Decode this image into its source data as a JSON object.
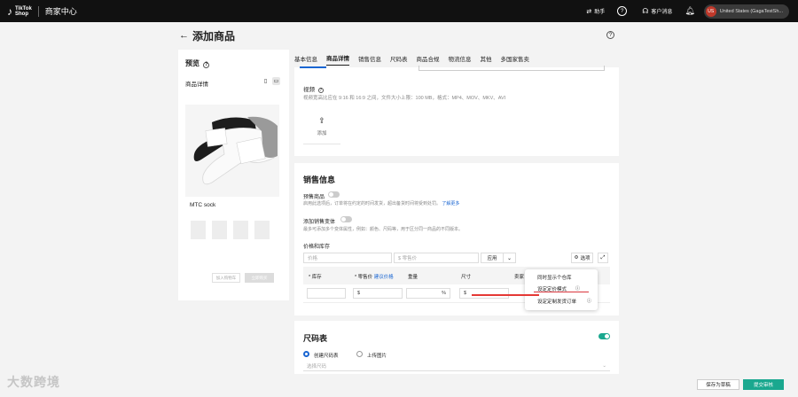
{
  "topbar": {
    "logo_mark": "♪",
    "logo_line1": "TikTok",
    "logo_line2": "Shop",
    "center": "商家中心",
    "help_label": "助手",
    "support_label": "客户消息",
    "account": "United States (GagaTestSh...",
    "avatar": "US"
  },
  "page": {
    "title": "添加商品",
    "back": "←"
  },
  "preview": {
    "title": "预览",
    "subtitle": "商品详情",
    "product_name": "MTC sock",
    "btn1": "加入购物车",
    "btn2": "立即购买"
  },
  "tabs": [
    "基本信息",
    "商品详情",
    "销售信息",
    "尺码表",
    "商品合规",
    "物流信息",
    "其他",
    "多国家售卖"
  ],
  "media": {
    "video_label": "视频",
    "video_desc": "视频宽高比应在 9:16 和 16:9 之间，文件大小上限：100 MB，格式：MP4、MOV、MKV、AVI",
    "upload_label": "添加"
  },
  "sales": {
    "title": "销售信息",
    "presale_label": "预售商品",
    "presale_desc": "启用此选项后，订单将在约定的时间发货，超出备货时间将受到处罚。",
    "presale_link": "了解更多",
    "variants_label": "添加销售变体",
    "variants_desc": "最多可添加多个变体属性，例如：颜色、尺码等，用于区分同一商品的不同版本。",
    "price_label": "价格和库存",
    "price_placeholder": "价格",
    "sku_placeholder": "$ 零售价",
    "apply_button": "应用",
    "columns_button": "选项",
    "col_stock": "* 库存",
    "col_price": "* 零售价",
    "col_price_link": "建议价格",
    "col_weight": "重量",
    "col_size": "尺寸",
    "col_sku": "卖家",
    "cell_currency": "$",
    "cell_unit": "%",
    "popup_items": [
      "同时显示个仓库",
      "设定定价模式",
      "设定定制发货订单"
    ]
  },
  "size_chart": {
    "title": "尺码表",
    "opt1": "创建尺码表",
    "opt2": "上传图片",
    "select_placeholder": "选择尺码"
  },
  "footer": {
    "save_draft": "保存为草稿",
    "submit": "提交审核"
  },
  "watermark": "大数跨境"
}
